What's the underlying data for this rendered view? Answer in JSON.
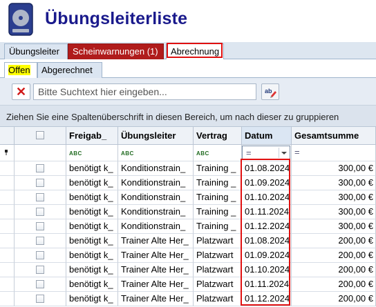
{
  "app": {
    "title": "Übungsleiterliste",
    "icon": "disk-icon"
  },
  "main_tabs": [
    {
      "label": "Übungsleiter"
    },
    {
      "label": "Scheinwarnungen (1)"
    },
    {
      "label": "Abrechnung"
    }
  ],
  "sub_tabs": [
    {
      "label": "Offen"
    },
    {
      "label": "Abgerechnet"
    }
  ],
  "search": {
    "placeholder": "Bitte Suchtext hier eingeben..."
  },
  "group_hint": "Ziehen Sie eine Spaltenüberschrift in diesen Bereich, um nach dieser zu gruppieren",
  "table": {
    "columns": [
      "",
      "Freigab_",
      "Übungsleiter",
      "Vertrag",
      "Datum",
      "Gesamtsumme"
    ],
    "filter_tokens": {
      "text": "ABC",
      "equals": "="
    },
    "rows": [
      [
        "benötigt k_",
        "Konditionstrain_",
        "Training _",
        "01.08.2024",
        "300,00 €"
      ],
      [
        "benötigt k_",
        "Konditionstrain_",
        "Training _",
        "01.09.2024",
        "300,00 €"
      ],
      [
        "benötigt k_",
        "Konditionstrain_",
        "Training _",
        "01.10.2024",
        "300,00 €"
      ],
      [
        "benötigt k_",
        "Konditionstrain_",
        "Training _",
        "01.11.2024",
        "300,00 €"
      ],
      [
        "benötigt k_",
        "Konditionstrain_",
        "Training _",
        "01.12.2024",
        "300,00 €"
      ],
      [
        "benötigt k_",
        "Trainer Alte Her_",
        "Platzwart",
        "01.08.2024",
        "200,00 €"
      ],
      [
        "benötigt k_",
        "Trainer Alte Her_",
        "Platzwart",
        "01.09.2024",
        "200,00 €"
      ],
      [
        "benötigt k_",
        "Trainer Alte Her_",
        "Platzwart",
        "01.10.2024",
        "200,00 €"
      ],
      [
        "benötigt k_",
        "Trainer Alte Her_",
        "Platzwart",
        "01.11.2024",
        "200,00 €"
      ],
      [
        "benötigt k_",
        "Trainer Alte Her_",
        "Platzwart",
        "01.12.2024",
        "200,00 €"
      ]
    ]
  },
  "colors": {
    "title": "#1a1a8c",
    "warning_tab": "#b01c1c",
    "highlight": "#e01010",
    "offen_highlight": "#ffff00"
  }
}
